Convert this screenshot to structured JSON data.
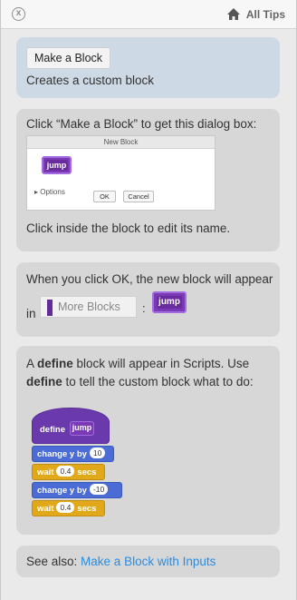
{
  "header": {
    "all_tips_label": "All Tips",
    "close_glyph": "x",
    "icons": [
      "close-icon",
      "home-icon"
    ]
  },
  "card1": {
    "button_label": "Make a Block",
    "description": "Creates a custom block"
  },
  "card2": {
    "line1": "Click “Make a Block” to get this dialog box:",
    "dialog": {
      "title": "New Block",
      "block_label": "jump",
      "options_label": "Options",
      "ok_label": "OK",
      "cancel_label": "Cancel"
    },
    "line2": "Click inside the block to edit its name."
  },
  "card3": {
    "line1": "When you click OK, the new block will appear",
    "in_label": "in",
    "category_label": "More Blocks",
    "colon": ":",
    "block_label": "jump"
  },
  "card4": {
    "line1_prefix": "A ",
    "line1_bold": "define",
    "line1_suffix": " block will appear in Scripts. Use",
    "line2_bold": "define",
    "line2_suffix": " to tell the custom block what to do:",
    "script": {
      "define_label": "define",
      "define_block": "jump",
      "blocks": [
        {
          "pre": "change y by",
          "value": "10",
          "post": ""
        },
        {
          "pre": "wait",
          "value": "0.4",
          "post": "secs"
        },
        {
          "pre": "change y by",
          "value": "-10",
          "post": ""
        },
        {
          "pre": "wait",
          "value": "0.4",
          "post": "secs"
        }
      ]
    }
  },
  "card5": {
    "prefix": "See also: ",
    "link_label": "Make a Block with Inputs"
  },
  "colors": {
    "panel_bg": "#eaeaea",
    "card_bg": "#d7d7d7",
    "highlight_card_bg": "#cdd9e5",
    "custom_block": "#7a39b5",
    "motion_block": "#4a6cd4",
    "control_block": "#e1a91a",
    "link": "#2a8ce0"
  }
}
